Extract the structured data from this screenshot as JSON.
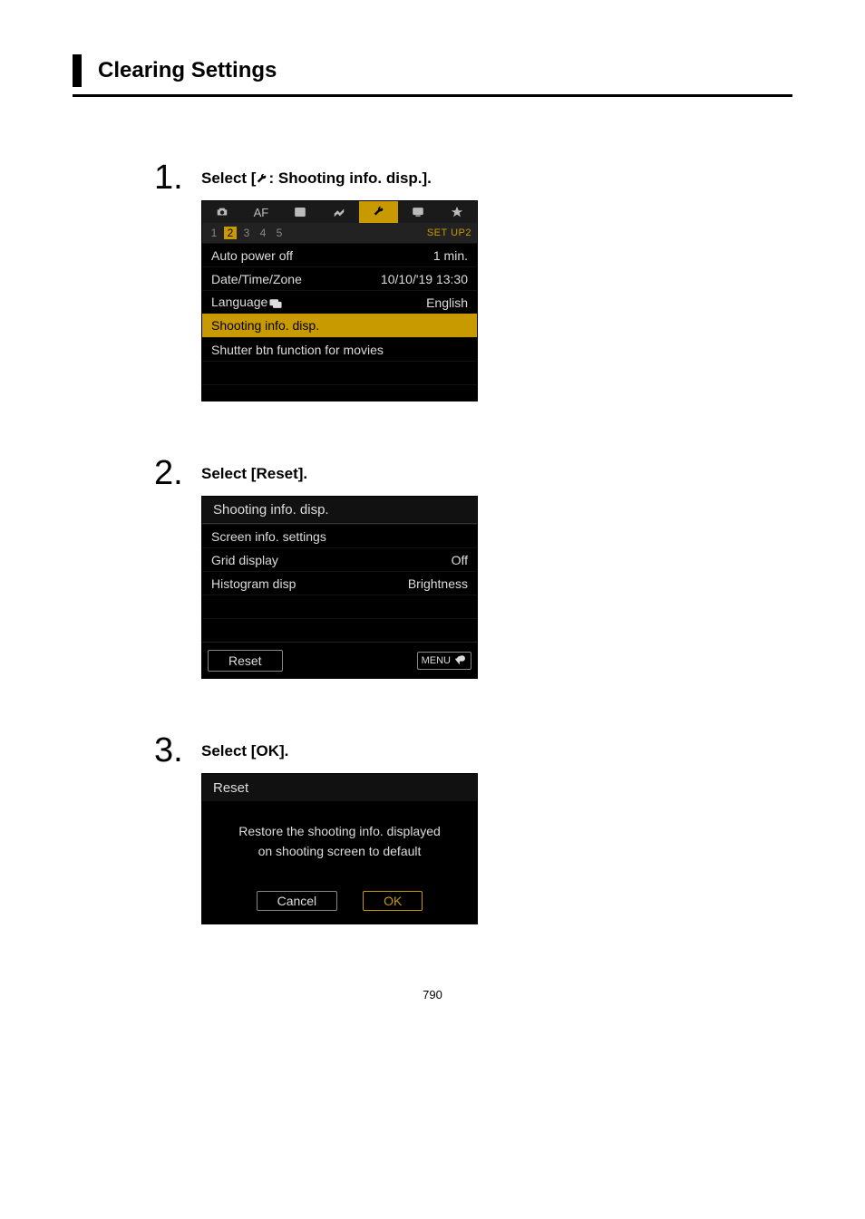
{
  "page_title": "Clearing Settings",
  "page_number": "790",
  "steps": [
    {
      "num": "1.",
      "title_pre": "Select [",
      "title_post": ": Shooting info. disp.]."
    },
    {
      "num": "2.",
      "title": "Select [Reset]."
    },
    {
      "num": "3.",
      "title": "Select [OK]."
    }
  ],
  "cam1": {
    "tabs": [
      "camera",
      "AF",
      "play",
      "net",
      "wrench",
      "display",
      "star"
    ],
    "active_tab_index": 4,
    "pages": [
      "1",
      "2",
      "3",
      "4",
      "5"
    ],
    "active_page_index": 1,
    "setup_label": "SET UP2",
    "rows": [
      {
        "label": "Auto power off",
        "value": "1 min."
      },
      {
        "label": "Date/Time/Zone",
        "value": "10/10/'19 13:30"
      },
      {
        "label": "Language",
        "value": "English",
        "has_lang_icon": true
      },
      {
        "label": "Shooting info. disp.",
        "value": "",
        "highlighted": true
      },
      {
        "label": "Shutter btn function for movies",
        "value": ""
      }
    ]
  },
  "cam2": {
    "title": "Shooting info. disp.",
    "rows": [
      {
        "label": "Screen info. settings",
        "value": ""
      },
      {
        "label": "Grid display",
        "value": "Off"
      },
      {
        "label": "Histogram disp",
        "value": "Brightness"
      }
    ],
    "reset_label": "Reset",
    "menu_label": "MENU"
  },
  "cam3": {
    "title": "Reset",
    "message_line1": "Restore the shooting info. displayed",
    "message_line2": "on shooting screen to default",
    "cancel_label": "Cancel",
    "ok_label": "OK"
  }
}
